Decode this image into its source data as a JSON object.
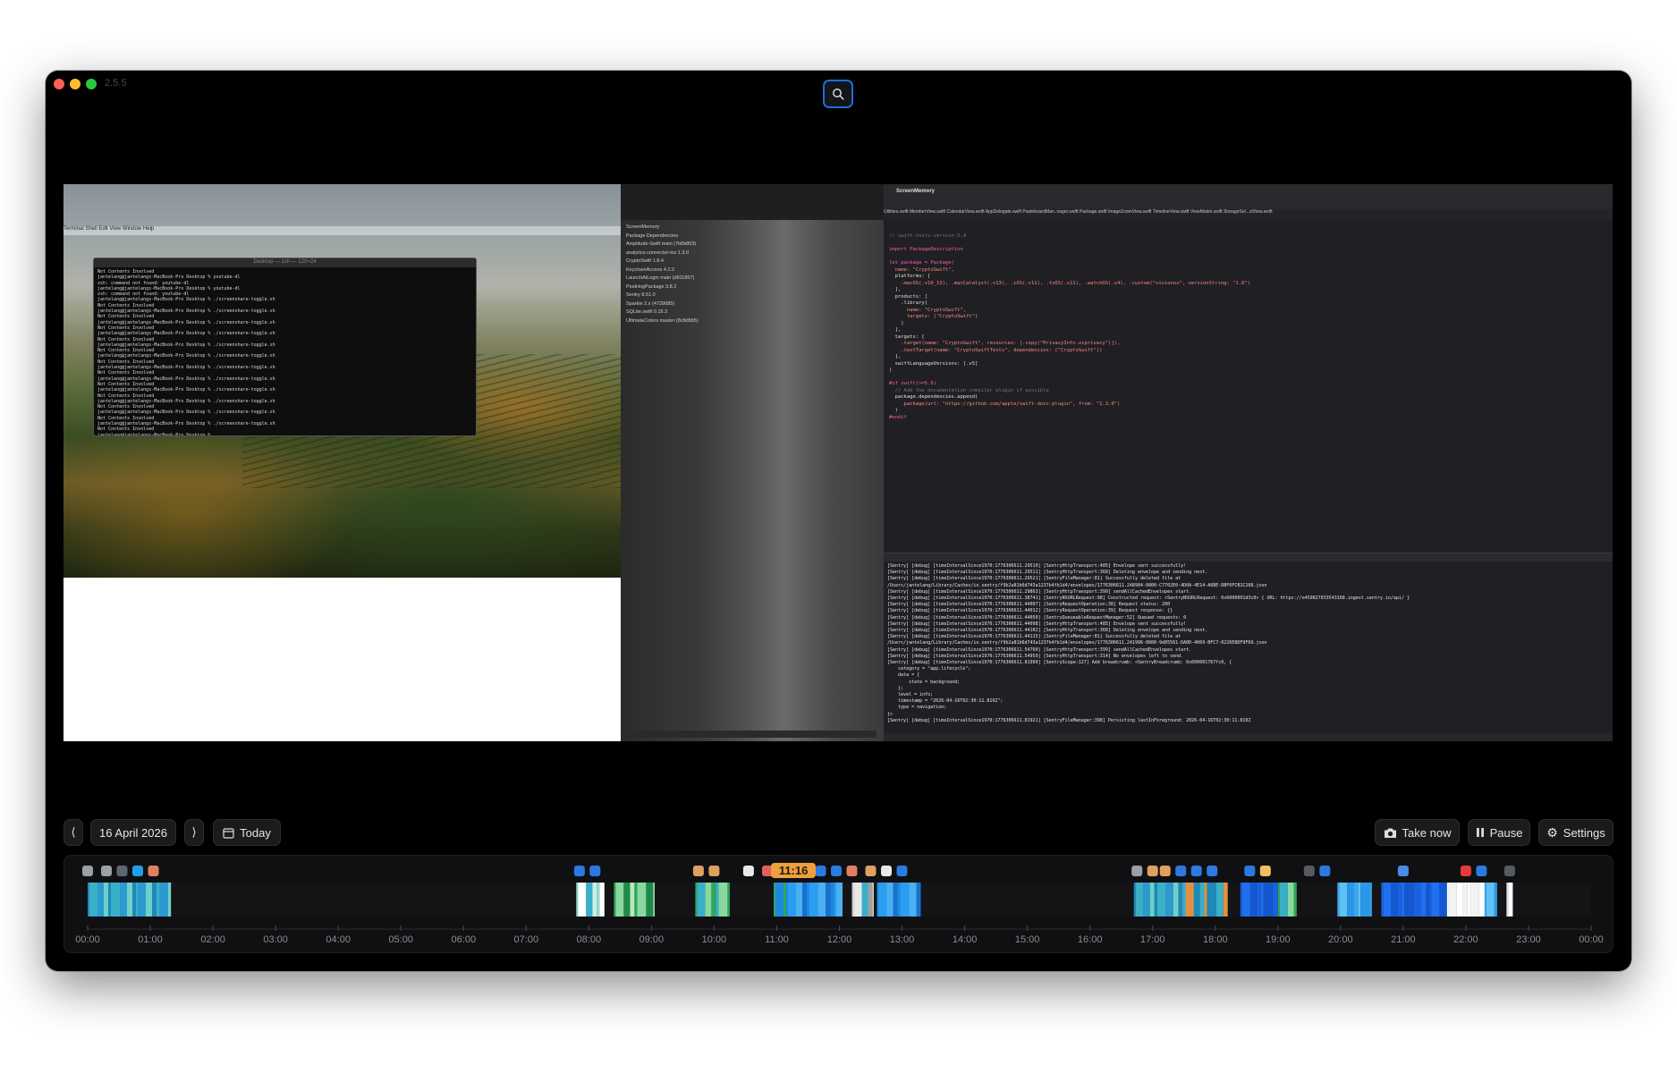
{
  "window": {
    "version": "2.5.5",
    "traffic_lights": [
      "#fe5f57",
      "#febc2e",
      "#28c840"
    ]
  },
  "search": {
    "icon": "search-icon",
    "accent": "#1d6ed8"
  },
  "preview": {
    "menubar": "Terminal  Shell  Edit  View  Window  Help",
    "terminal_title": "Desktop — zsh — 120×24",
    "terminal_lines": [
      "Not Contents Involved",
      "jantelang@jantelangs-MacBook-Pro Desktop % youtube-dl",
      "zsh: command not found: youtube-dl",
      "jantelang@jantelangs-MacBook-Pro Desktop % youtube-dl",
      "zsh: command not found: youtube-dl",
      "jantelang@jantelangs-MacBook-Pro Desktop % ./screenshare-toggle.sh",
      "Not Contents Involved",
      "jantelang@jantelangs-MacBook-Pro Desktop % ./screenshare-toggle.sh",
      "Not Contents Involved",
      "jantelang@jantelangs-MacBook-Pro Desktop % ./screenshare-toggle.sh",
      "Not Contents Involved",
      "jantelang@jantelangs-MacBook-Pro Desktop % ./screenshare-toggle.sh",
      "Not Contents Involved",
      "jantelang@jantelangs-MacBook-Pro Desktop % ./screenshare-toggle.sh",
      "Not Contents Involved",
      "jantelang@jantelangs-MacBook-Pro Desktop % ./screenshare-toggle.sh",
      "Not Contents Involved",
      "jantelang@jantelangs-MacBook-Pro Desktop % ./screenshare-toggle.sh",
      "Not Contents Involved",
      "jantelang@jantelangs-MacBook-Pro Desktop % ./screenshare-toggle.sh",
      "Not Contents Involved",
      "jantelang@jantelangs-MacBook-Pro Desktop % ./screenshare-toggle.sh",
      "Not Contents Involved",
      "jantelang@jantelangs-MacBook-Pro Desktop % ./screenshare-toggle.sh",
      "Not Contents Involved",
      "jantelang@jantelangs-MacBook-Pro Desktop % ./screenshare-toggle.sh",
      "Not Contents Involved",
      "jantelang@jantelangs-MacBook-Pro Desktop % ./screenshare-toggle.sh",
      "Not Contents Involved",
      "jantelang@jantelangs-MacBook-Pro Desktop %"
    ],
    "navigator_items": [
      "ScreenMemory",
      "Package Dependencies",
      "Amplitude-Swift main (7b6b803)",
      "analytics-connector-ios 1.3.0",
      "CryptoSwift 1.8.4",
      "KeychainAccess 4.2.2",
      "LaunchAtLogin main (d811857)",
      "PostHogPackage 3.8.2",
      "Sentry 8.51.0",
      "Sparkle 2.x (4729085)",
      "SQLite.swift 0.15.3",
      "UltimateColors master (8c8d9b5)"
    ],
    "editor_title": "ScreenMemory",
    "editor_tabs": "Utilities.swift   MemberView.swift   CalendarView.swift   AppDelegate.swift   PasteboardMan..nager.swift   Package.swift   ImageZoomView.swift   TimelineView.swift   ViewModel.swift   StorageSel...ctView.swift",
    "code_lines": [
      "// swift-tools-version:5.4",
      "",
      "import PackageDescription",
      "",
      "let package = Package(",
      "  name: \"CryptoSwift\",",
      "  platforms: [",
      "    .macOS(.v10_13), .macCatalyst(.v13), .iOS(.v11), .tvOS(.v11), .watchOS(.v4), .custom(\"visionos\", versionString: \"1.0\")",
      "  ],",
      "  products: [",
      "    .library(",
      "      name: \"CryptoSwift\",",
      "      targets: [\"CryptoSwift\"]",
      "    )",
      "  ],",
      "  targets: [",
      "    .target(name: \"CryptoSwift\", resources: [.copy(\"PrivacyInfo.xcprivacy\")]),",
      "    .testTarget(name: \"CryptoSwiftTests\", dependencies: [\"CryptoSwift\"])",
      "  ],",
      "  swiftLanguageVersions: [.v5]",
      ")",
      "",
      "#if swift(>=5.6)",
      "  // Add the documentation compiler plugin if possible",
      "  package.dependencies.append(",
      "    .package(url: \"https://github.com/apple/swift-docc-plugin\", from: \"1.3.0\")",
      "  )",
      "#endif"
    ],
    "console_lines": [
      "[Sentry] [debug] [timeIntervalSince1970:1776306611.29510] [SentryHttpTransport:485] Envelope sent successfully!",
      "[Sentry] [debug] [timeIntervalSince1970:1776306611.29511] [SentryHttpTransport:368] Deleting envelope and sending next.",
      "[Sentry] [debug] [timeIntervalSince1970:1776306611.29521] [SentryFileManager:81] Successfully deleted file at",
      "/Users/jantelang/Library/Caches/io.sentry/f9b2a81b6d743a1237b4fb1d4/envelopes/1776306611.248904-0800-C7702E0-4D0A-4E14-A6BE-DBF0FCB1C268.json",
      "[Sentry] [debug] [timeIntervalSince1970:1776306611.29863] [SentryHttpTransport:399] sendAllCachedEnvelopes start.",
      "[Sentry] [debug] [timeIntervalSince1970:1776306611.38741] [SentryNSURLRequest:98] Constructed request: <SentryNSURLRequest: 0x6000001d3c0> { URL: https://o450827033543168.ingest.sentry.io/api/ }",
      "[Sentry] [debug] [timeIntervalSince1970:1776306611.44007] [SentryRequestOperation:38] Request status: 200",
      "[Sentry] [debug] [timeIntervalSince1970:1776306611.44012] [SentryRequestOperation:39] Request response: {}",
      "[Sentry] [debug] [timeIntervalSince1970:1776306611.44050] [SentryQueueableRequestManager:52] Queued requests: 0",
      "[Sentry] [debug] [timeIntervalSince1970:1776306611.44098] [SentryHttpTransport:485] Envelope sent successfully!",
      "[Sentry] [debug] [timeIntervalSince1970:1776306611.44102] [SentryHttpTransport:368] Deleting envelope and sending next.",
      "[Sentry] [debug] [timeIntervalSince1970:1776306611.44115] [SentryFileManager:81] Successfully deleted file at",
      "/Users/jantelang/Library/Caches/io.sentry/f9b2a81b6d743a1237b4fb1d4/envelopes/1776306611.241996-0800-9d85561-DA0D-4069-BFC7-0226E8DF9F69.json",
      "[Sentry] [debug] [timeIntervalSince1970:1776306611.54760] [SentryHttpTransport:399] sendAllCachedEnvelopes start.",
      "[Sentry] [debug] [timeIntervalSince1970:1776306611.54959] [SentryHttpTransport:314] No envelopes left to send.",
      "[Sentry] [debug] [timeIntervalSince1970:1776306611.81900] [SentryScope:127] Add breadcrumb: <SentryBreadcrumb: 0x600001767fc0, {",
      "    category = \"app.lifecycle\";",
      "    data = {",
      "        state = background;",
      "    };",
      "    level = info;",
      "    timestamp = \"2026-04-16T02:30:11.819Z\";",
      "    type = navigation;",
      "}>",
      "[Sentry] [debug] [timeIntervalSince1970:1776306611.81921] [SentryFileManager:398] Persisting lastInForeground: 2026-04-16T02:30:11.819Z"
    ]
  },
  "controls": {
    "prev_icon": "chevron-left-icon",
    "prev_glyph": "⟨",
    "date": "16 April 2026",
    "next_icon": "chevron-right-icon",
    "next_glyph": "⟩",
    "today_icon": "calendar-icon",
    "today": "Today",
    "take_now_icon": "camera-icon",
    "take_now": "Take now",
    "pause_icon": "pause-icon",
    "pause": "Pause",
    "settings_icon": "gear-icon",
    "settings": "Settings"
  },
  "timeline": {
    "current_time": "11:16",
    "accent": "#f0a03a",
    "ticks": [
      "00:00",
      "01:00",
      "02:00",
      "03:00",
      "04:00",
      "05:00",
      "06:00",
      "07:00",
      "08:00",
      "09:00",
      "10:00",
      "11:00",
      "12:00",
      "13:00",
      "14:00",
      "15:00",
      "16:00",
      "17:00",
      "18:00",
      "19:00",
      "20:00",
      "21:00",
      "22:00",
      "23:00",
      "00:00"
    ],
    "segments": [
      {
        "start": 0.0,
        "end": 1.33,
        "style": "teal"
      },
      {
        "start": 7.8,
        "end": 8.25,
        "style": "teal-light"
      },
      {
        "start": 8.4,
        "end": 9.05,
        "style": "green"
      },
      {
        "start": 10.95,
        "end": 11.55,
        "style": "mix"
      },
      {
        "start": 11.15,
        "end": 12.05,
        "style": "blue"
      },
      {
        "start": 12.2,
        "end": 12.55,
        "style": "gray"
      },
      {
        "start": 12.6,
        "end": 13.3,
        "style": "blue"
      },
      {
        "start": 9.7,
        "end": 10.25,
        "style": "green-teal"
      },
      {
        "start": 16.7,
        "end": 17.85,
        "style": "teal"
      },
      {
        "start": 17.5,
        "end": 18.2,
        "style": "orange-mix"
      },
      {
        "start": 18.4,
        "end": 19.0,
        "style": "blue-strong"
      },
      {
        "start": 19.0,
        "end": 19.3,
        "style": "green-teal"
      },
      {
        "start": 19.95,
        "end": 20.5,
        "style": "sky"
      },
      {
        "start": 20.65,
        "end": 21.7,
        "style": "blue-strong"
      },
      {
        "start": 21.7,
        "end": 22.3,
        "style": "white"
      },
      {
        "start": 22.3,
        "end": 22.5,
        "style": "sky"
      },
      {
        "start": 22.65,
        "end": 22.75,
        "style": "pale"
      }
    ],
    "app_icons": [
      {
        "hour": 0.0,
        "color": "#9aa0a6"
      },
      {
        "hour": 0.3,
        "color": "#9aa0a6"
      },
      {
        "hour": 0.55,
        "color": "#5b6770"
      },
      {
        "hour": 0.8,
        "color": "#1ea0e8"
      },
      {
        "hour": 1.05,
        "color": "#e08060"
      },
      {
        "hour": 7.85,
        "color": "#2a7ae2"
      },
      {
        "hour": 8.1,
        "color": "#2a7ae2"
      },
      {
        "hour": 9.75,
        "color": "#e0a060"
      },
      {
        "hour": 10.0,
        "color": "#e0a060"
      },
      {
        "hour": 10.55,
        "color": "#e8e8e8"
      },
      {
        "hour": 10.85,
        "color": "#e06060"
      },
      {
        "hour": 11.1,
        "color": "#2a7ae2"
      },
      {
        "hour": 11.4,
        "color": "#2a7ae2"
      },
      {
        "hour": 11.7,
        "color": "#2a7ae2"
      },
      {
        "hour": 11.95,
        "color": "#2a7ae2"
      },
      {
        "hour": 12.2,
        "color": "#e08060"
      },
      {
        "hour": 12.5,
        "color": "#e0a060"
      },
      {
        "hour": 12.75,
        "color": "#e8e8e8"
      },
      {
        "hour": 13.0,
        "color": "#2a7ae2"
      },
      {
        "hour": 16.75,
        "color": "#9aa0a6"
      },
      {
        "hour": 17.0,
        "color": "#e0a060"
      },
      {
        "hour": 17.2,
        "color": "#e0a060"
      },
      {
        "hour": 17.45,
        "color": "#2a7ae2"
      },
      {
        "hour": 17.7,
        "color": "#2a7ae2"
      },
      {
        "hour": 17.95,
        "color": "#2a7ae2"
      },
      {
        "hour": 18.55,
        "color": "#2a7ae2"
      },
      {
        "hour": 18.8,
        "color": "#f0c060"
      },
      {
        "hour": 19.5,
        "color": "#555b60"
      },
      {
        "hour": 19.75,
        "color": "#2a7ae2"
      },
      {
        "hour": 21.0,
        "color": "#4a8ae8"
      },
      {
        "hour": 22.0,
        "color": "#e83a3a"
      },
      {
        "hour": 22.25,
        "color": "#2a7ae2"
      },
      {
        "hour": 22.7,
        "color": "#555b60"
      }
    ]
  }
}
